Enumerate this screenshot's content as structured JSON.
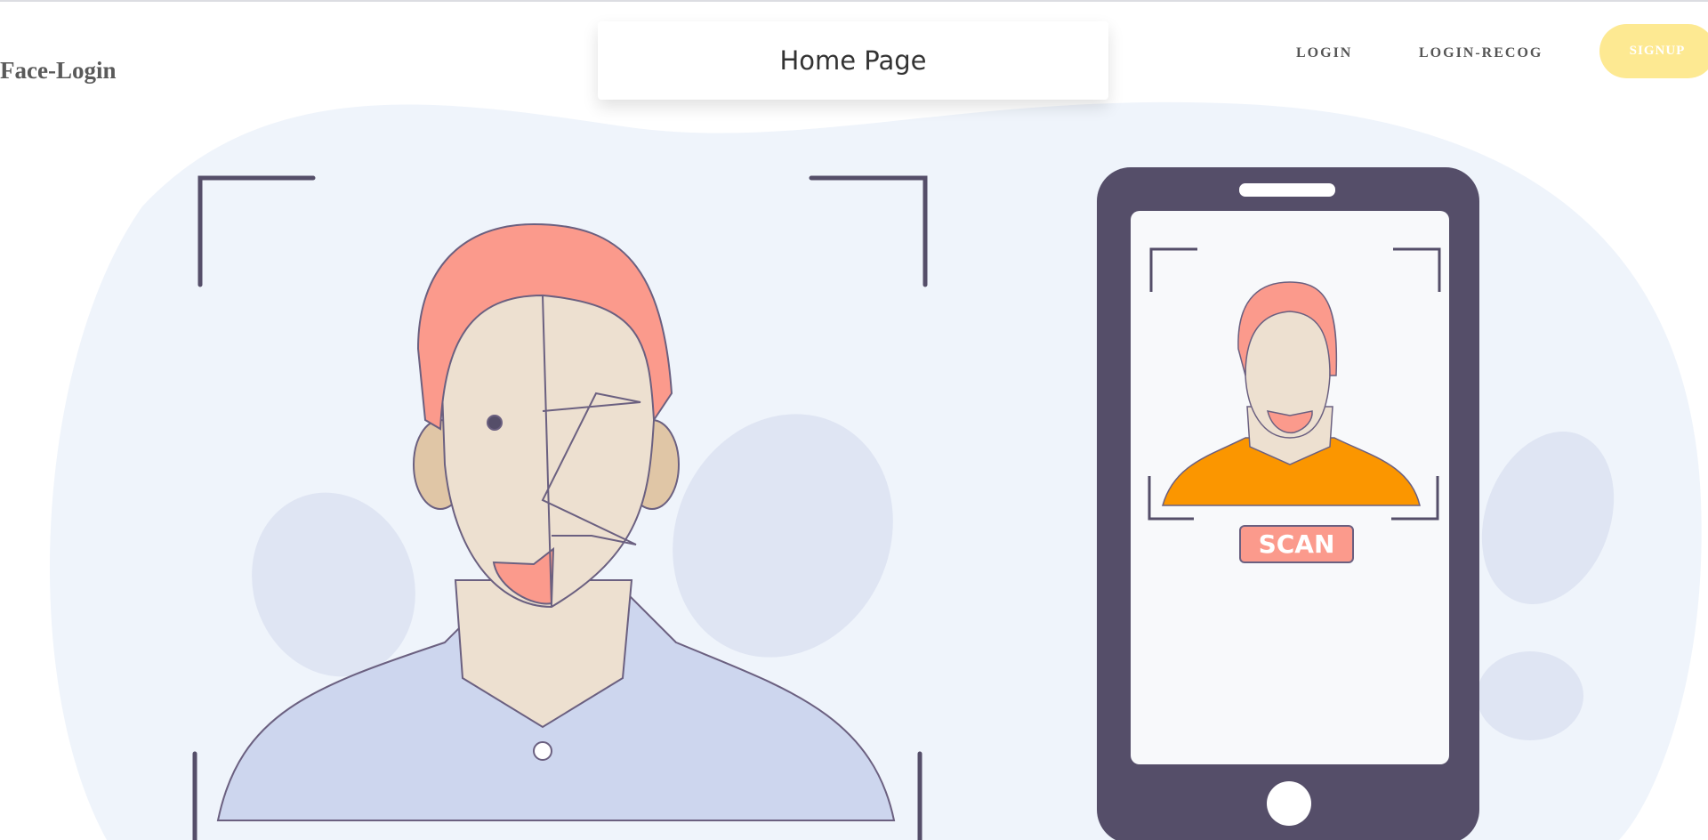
{
  "header": {
    "brand": "Face-Login",
    "page_title": "Home Page",
    "nav": [
      {
        "label": "LOGIN"
      },
      {
        "label": "LOGIN-RECOG"
      },
      {
        "label": "SIGNUP"
      }
    ]
  },
  "hero": {
    "scan_label": "SCAN"
  },
  "colors": {
    "signup": "#fde992",
    "phone": "#554e69",
    "hair": "#fb9a8c",
    "shirt_phone": "#fb9600",
    "shirt": "#cdd6ee",
    "blob": "#eff4fb"
  }
}
